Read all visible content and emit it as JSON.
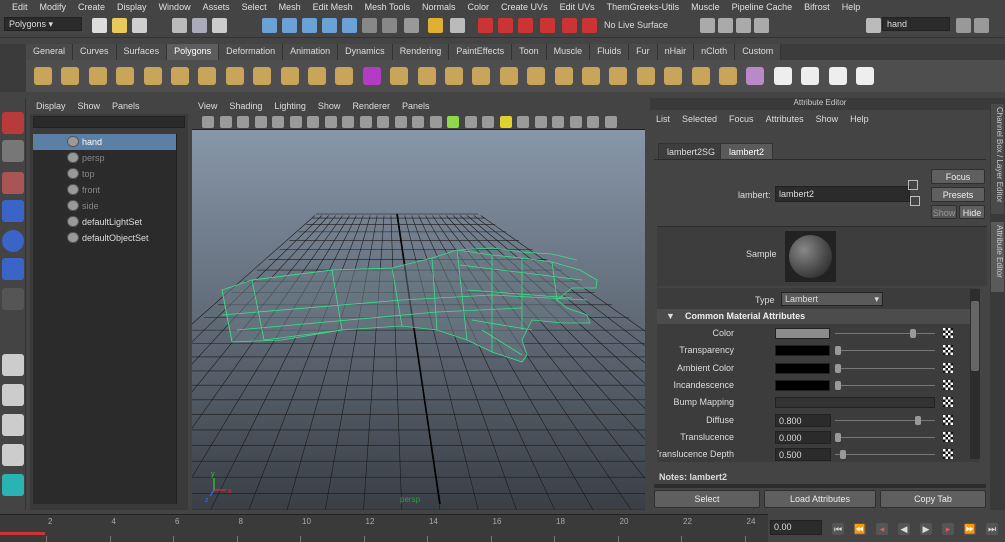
{
  "menubar": [
    "Edit",
    "Modify",
    "Create",
    "Display",
    "Window",
    "Assets",
    "Select",
    "Mesh",
    "Edit Mesh",
    "Mesh Tools",
    "Normals",
    "Color",
    "Create UVs",
    "Edit UVs",
    "ThemGreeks-Utils",
    "Muscle",
    "Pipeline Cache",
    "Bifrost",
    "Help"
  ],
  "status": {
    "mode": "Polygons",
    "live_surface": "No Live Surface",
    "search": "hand"
  },
  "shelf_tabs": [
    {
      "label": "General"
    },
    {
      "label": "Curves"
    },
    {
      "label": "Surfaces"
    },
    {
      "label": "Polygons",
      "active": true
    },
    {
      "label": "Deformation"
    },
    {
      "label": "Animation"
    },
    {
      "label": "Dynamics"
    },
    {
      "label": "Rendering"
    },
    {
      "label": "PaintEffects"
    },
    {
      "label": "Toon"
    },
    {
      "label": "Muscle"
    },
    {
      "label": "Fluids"
    },
    {
      "label": "Fur"
    },
    {
      "label": "nHair"
    },
    {
      "label": "nCloth"
    },
    {
      "label": "Custom"
    }
  ],
  "outliner": {
    "menu": [
      "Display",
      "Show",
      "Panels"
    ],
    "items": [
      {
        "label": "hand",
        "selected": true
      },
      {
        "label": "persp",
        "dim": true
      },
      {
        "label": "top",
        "dim": true
      },
      {
        "label": "front",
        "dim": true
      },
      {
        "label": "side",
        "dim": true
      },
      {
        "label": "defaultLightSet"
      },
      {
        "label": "defaultObjectSet"
      }
    ]
  },
  "viewport": {
    "menu": [
      "View",
      "Shading",
      "Lighting",
      "Show",
      "Renderer",
      "Panels"
    ],
    "camera_label": "persp",
    "axis": {
      "x": "x",
      "y": "y",
      "z": "z"
    }
  },
  "attribute_editor": {
    "title": "Attribute Editor",
    "menu": [
      "List",
      "Selected",
      "Focus",
      "Attributes",
      "Show",
      "Help"
    ],
    "tabs": [
      {
        "label": "lambert2SG"
      },
      {
        "label": "lambert2",
        "active": true
      }
    ],
    "node_label": "lambert:",
    "node_name": "lambert2",
    "focus": "Focus",
    "presets": "Presets",
    "show": "Show",
    "hide": "Hide",
    "sample_label": "Sample",
    "type_label": "Type",
    "type_value": "Lambert",
    "section": "Common Material Attributes",
    "attrs": [
      {
        "label": "Color",
        "swatch": "#8c8c8c",
        "knob": 0.75
      },
      {
        "label": "Transparency",
        "swatch": "#000000",
        "knob": 0.0
      },
      {
        "label": "Ambient Color",
        "swatch": "#000000",
        "knob": 0.0
      },
      {
        "label": "Incandescence",
        "swatch": "#000000",
        "knob": 0.0
      },
      {
        "label": "Bump Mapping",
        "swatch": null,
        "knob": null
      },
      {
        "label": "Diffuse",
        "value": "0.800",
        "knob": 0.8
      },
      {
        "label": "Translucence",
        "value": "0.000",
        "knob": 0.0
      },
      {
        "label": "Translucence Depth",
        "value": "0.500",
        "knob": 0.05
      }
    ],
    "notes": "Notes:  lambert2",
    "buttons": [
      "Select",
      "Load Attributes",
      "Copy Tab"
    ]
  },
  "side_tabs": [
    "Channel Box / Layer Editor",
    "Attribute Editor"
  ],
  "timeline": {
    "ticks": [
      "2",
      "4",
      "6",
      "8",
      "10",
      "12",
      "14",
      "16",
      "18",
      "20",
      "22",
      "24"
    ],
    "current": "0.00"
  }
}
